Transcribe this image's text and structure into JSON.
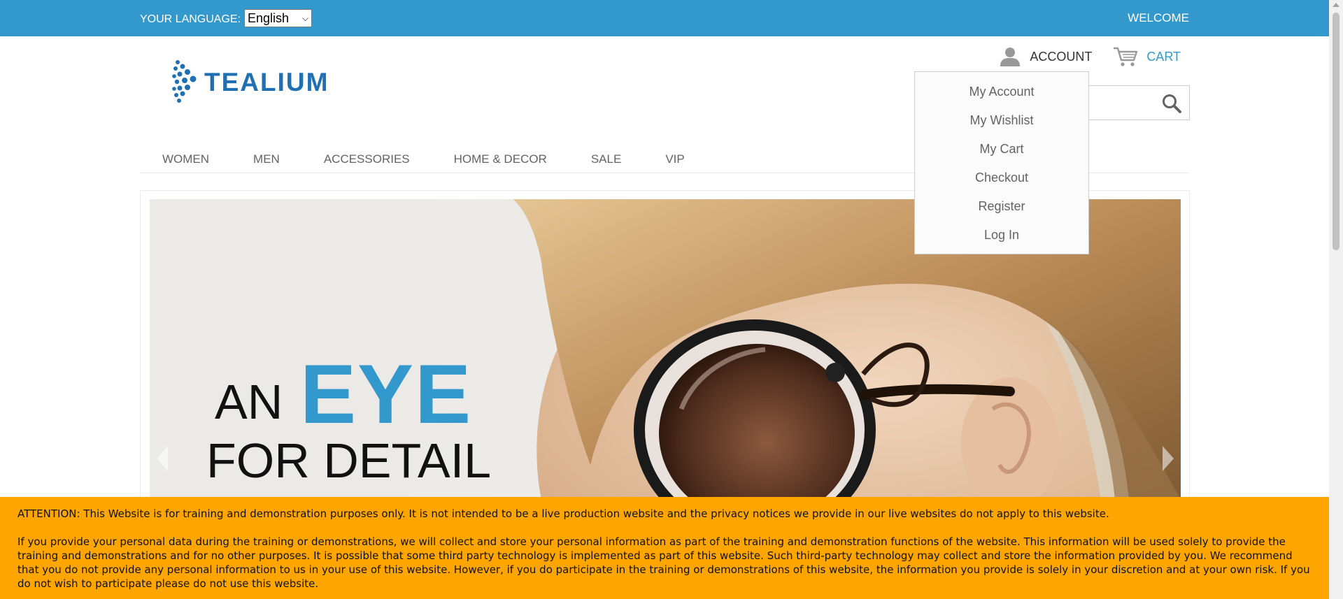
{
  "topbar": {
    "language_label": "YOUR LANGUAGE:",
    "language_selected": "English",
    "welcome": "WELCOME",
    "bg_color": "#3399cc"
  },
  "header": {
    "logo_text": "TEALIUM",
    "account_label": "ACCOUNT",
    "cart_label": "CART",
    "account_icon": "user-icon",
    "cart_icon": "cart-icon",
    "search_icon": "search-icon"
  },
  "account_menu": {
    "items": [
      {
        "label": "My Account"
      },
      {
        "label": "My Wishlist"
      },
      {
        "label": "My Cart"
      },
      {
        "label": "Checkout"
      },
      {
        "label": "Register"
      },
      {
        "label": "Log In"
      }
    ]
  },
  "nav": {
    "items": [
      {
        "label": "WOMEN"
      },
      {
        "label": "MEN"
      },
      {
        "label": "ACCESSORIES"
      },
      {
        "label": "HOME & DECOR"
      },
      {
        "label": "SALE"
      },
      {
        "label": "VIP"
      }
    ]
  },
  "banner": {
    "word1": "AN",
    "word2": "EYE",
    "word3": "FOR DETAIL",
    "accent_color": "#3399cc"
  },
  "notice": {
    "p1": "ATTENTION: This Website is for training and demonstration purposes only. It is not intended to be a live production website and the privacy notices we provide in our live websites do not apply to this website.",
    "p2": "If you provide your personal data during the training or demonstrations, we will collect and store your personal information as part of the training and demonstration functions of the website. This information will be used solely to provide the training and demonstrations and for no other purposes. It is possible that some third party technology is implemented as part of this website. Such third-party technology may collect and store the information provided by you. We recommend that you do not provide any personal information to us in your use of this website. However, if you do participate in the training or demonstrations of this website, the information you provide is solely in your discretion and at your own risk. If you do not wish to participate please do not use this website.",
    "bg_color": "#ffa500"
  }
}
